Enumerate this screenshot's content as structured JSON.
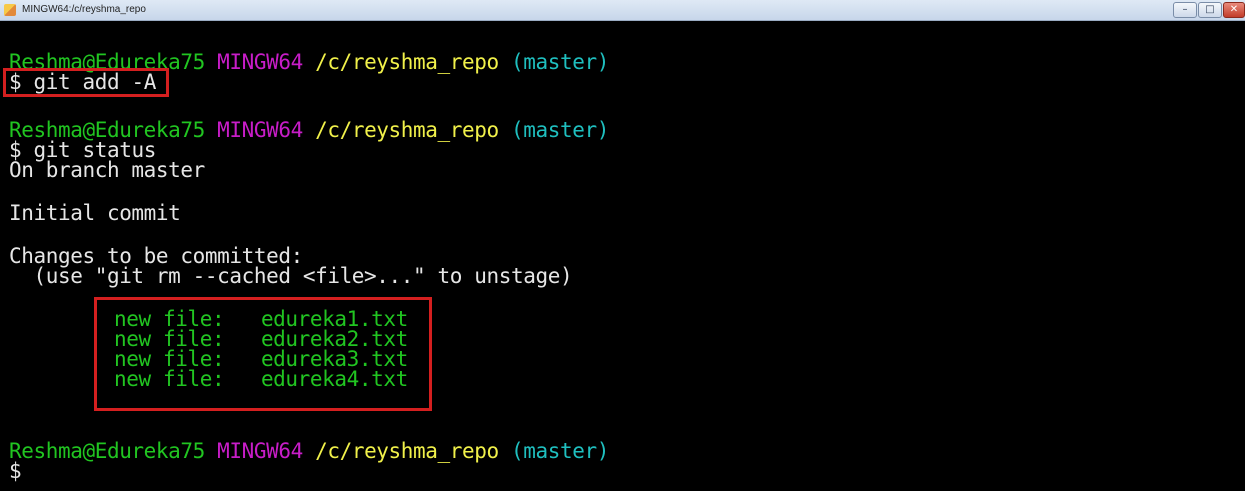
{
  "window": {
    "title": "MINGW64:/c/reyshma_repo",
    "controls": {
      "minimize": "–",
      "maximize": "□",
      "close": "✕"
    }
  },
  "colors": {
    "background": "#000000",
    "user_host": "#21c521",
    "shell_name": "#c81dc8",
    "path": "#f1f14a",
    "branch": "#1fbfbf",
    "highlight_box": "#d41f1f"
  },
  "prompt": {
    "user_host": "Reshma@Edureka75",
    "shell": "MINGW64",
    "path": "/c/reyshma_repo",
    "branch": "(master)",
    "symbol": "$"
  },
  "commands": {
    "add": "git add -A",
    "status": "git status"
  },
  "output": {
    "on_branch": "On branch master",
    "initial_commit": "Initial commit",
    "changes_header": "Changes to be committed:",
    "hint": "  (use \"git rm --cached <file>...\" to unstage)",
    "files": [
      {
        "status": "new file:",
        "name": "edureka1.txt"
      },
      {
        "status": "new file:",
        "name": "edureka2.txt"
      },
      {
        "status": "new file:",
        "name": "edureka3.txt"
      },
      {
        "status": "new file:",
        "name": "edureka4.txt"
      }
    ]
  }
}
